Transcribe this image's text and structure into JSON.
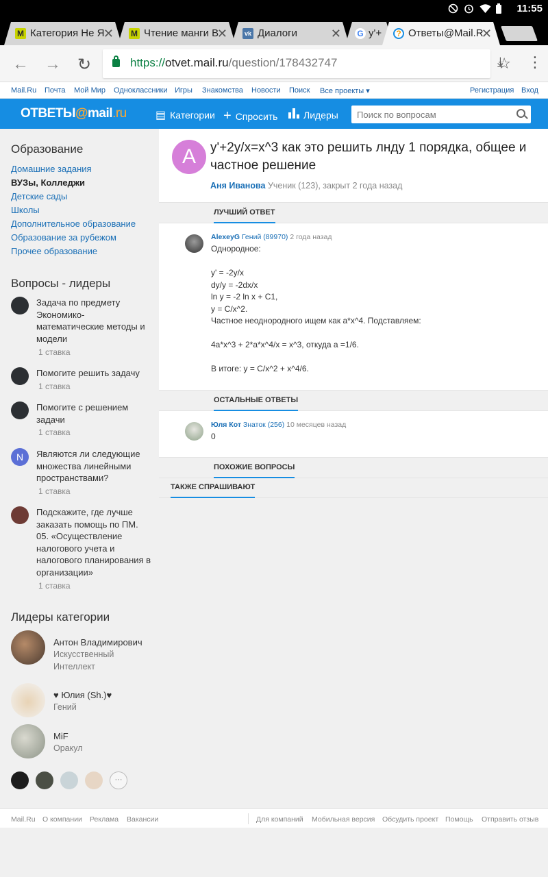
{
  "status_bar": {
    "time": "11:55",
    "icons": [
      "dnd-icon",
      "alarm-icon",
      "wifi-icon",
      "battery-icon"
    ]
  },
  "tabs": [
    {
      "title": "Категория Не Я",
      "favicon": "M"
    },
    {
      "title": "Чтение манги В",
      "favicon": "M"
    },
    {
      "title": "Диалоги",
      "favicon": "vk"
    },
    {
      "title": "y'+",
      "favicon": "G"
    },
    {
      "title": "Ответы@Mail.R",
      "favicon": "?"
    }
  ],
  "address_bar": {
    "scheme": "https://",
    "host": "otvet.mail.ru",
    "path": "/question/178432747"
  },
  "portal": {
    "left": [
      "Mail.Ru",
      "Почта",
      "Мой Мир",
      "Одноклассники",
      "Игры",
      "Знакомства",
      "Новости",
      "Поиск",
      "Все проекты ▾"
    ],
    "right": [
      "Регистрация",
      "Вход"
    ]
  },
  "header": {
    "logo_text": "ОТВЕТЫ",
    "logo_at": "@",
    "logo_mail": "mail",
    "logo_ru": ".ru",
    "nav": [
      "Категории",
      "Спросить",
      "Лидеры"
    ],
    "search_placeholder": "Поиск по вопросам"
  },
  "sidebar": {
    "section_title": "Образование",
    "categories": [
      "Домашние задания",
      "ВУЗы, Колледжи",
      "Детские сады",
      "Школы",
      "Дополнительное образование",
      "Образование за рубежом",
      "Прочее образование"
    ],
    "selected_category": "ВУЗы, Колледжи",
    "leaders_title": "Вопросы - лидеры",
    "leader_questions": [
      {
        "text": "Задача по предмету Экономико-математические методы и модели",
        "stakes": "1 ставка"
      },
      {
        "text": "Помогите решить задачу",
        "stakes": "1 ставка"
      },
      {
        "text": "Помогите с решением задачи",
        "stakes": "1 ставка"
      },
      {
        "text": "Являются ли следующие множества линейными пространствами?",
        "stakes": "1 ставка",
        "avatar_letter": "N"
      },
      {
        "text": "Подскажите, где лучше заказать помощь по ПМ. 05. «Осуществление налогового учета и налогового планирования в организации»",
        "stakes": "1 ставка"
      }
    ],
    "category_leaders_title": "Лидеры категории",
    "category_leaders": [
      {
        "name": "Антон Владимирович",
        "rank": "Искусственный Интеллект"
      },
      {
        "name": "♥ Юлия (Sh.)♥",
        "rank": "Гений"
      },
      {
        "name": "MiF",
        "rank": "Оракул"
      }
    ],
    "more_label": "···"
  },
  "question": {
    "avatar_letter": "А",
    "title": "y'+2y/x=x^3 как это решить лнду 1 порядка, общее и частное решение",
    "author": "Аня Иванова",
    "meta": "Ученик (123), закрыт 2 года назад"
  },
  "best_answer": {
    "section_label": "ЛУЧШИЙ ОТВЕТ",
    "author": "AlexeyG",
    "rank": "Гений (89970)",
    "time": "2 года назад",
    "text": "Однородное:\n\ny' = -2y/x\ndy/y = -2dx/x\nln y = -2 ln x + C1,\ny = C/x^2.\nЧастное неоднородного ищем как a*x^4. Подставляем:\n\n4a*x^3 + 2*a*x^4/x = x^3, откуда a =1/6.\n\nВ итоге: y = C/x^2 + x^4/6."
  },
  "other_answers": {
    "section_label": "ОСТАЛЬНЫЕ ОТВЕТЫ",
    "items": [
      {
        "author": "Юля Кот",
        "rank": "Знаток (256)",
        "time": "10 месяцев назад",
        "text": "0"
      }
    ]
  },
  "similar_label": "ПОХОЖИЕ ВОПРОСЫ",
  "also_asked_label": "ТАКЖЕ СПРАШИВАЮТ",
  "footer": {
    "left": [
      "Mail.Ru",
      "О компании",
      "Реклама",
      "Вакансии"
    ],
    "right": [
      "Для компаний",
      "Мобильная версия",
      "Обсудить проект",
      "Помощь",
      "Отправить отзыв"
    ]
  },
  "colors": {
    "brand_blue": "#168de2",
    "link": "#1a6fb6",
    "logo_accent": "#ffa930",
    "question_avatar": "#d67fd9"
  }
}
